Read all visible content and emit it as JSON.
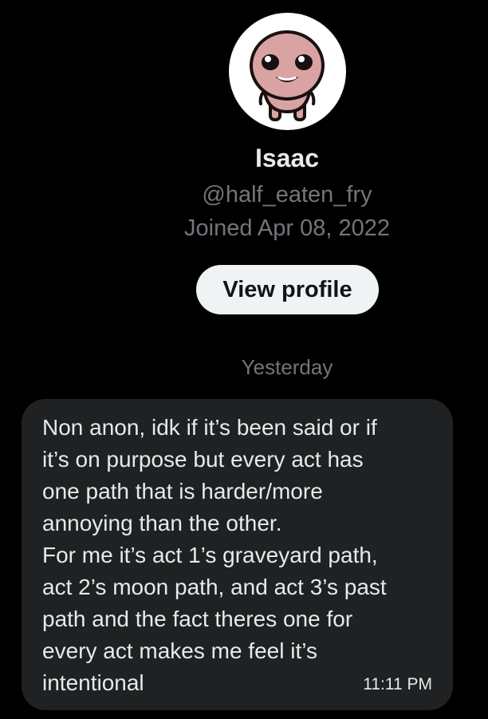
{
  "profile": {
    "display_name": "Isaac",
    "handle": "@half_eaten_fry",
    "joined": "Joined Apr 08, 2022",
    "view_profile_label": "View profile"
  },
  "avatar": {
    "icon": "cartoon-character-avatar",
    "skin_color": "#d9a3a3",
    "outline_color": "#1a1010"
  },
  "conversation": {
    "date_separator": "Yesterday",
    "messages": [
      {
        "lines": [
          "Non anon, idk if it’s been said or if",
          "it’s on purpose but every act has",
          "one path that is harder/more",
          "annoying than the other.",
          "For me it’s act 1’s graveyard path,",
          "act 2’s moon path, and act 3’s past",
          "path and the fact theres one for",
          "every act makes me feel it’s",
          "intentional"
        ],
        "time": "11:11 PM"
      }
    ]
  },
  "colors": {
    "background": "#000000",
    "primary_text": "#e7e9ea",
    "secondary_text": "#71767b",
    "bubble": "#1f2123",
    "button_bg": "#eff3f4"
  }
}
